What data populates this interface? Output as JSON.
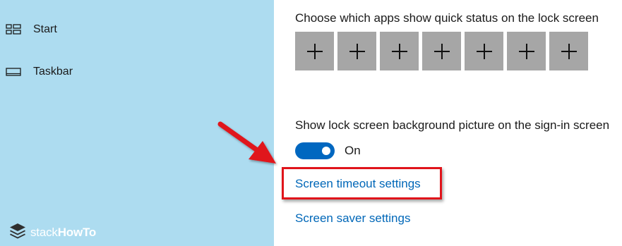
{
  "sidebar": {
    "background": "#addcf0",
    "items": [
      {
        "label": "Start",
        "icon": "start-icon"
      },
      {
        "label": "Taskbar",
        "icon": "taskbar-icon"
      }
    ],
    "watermark": {
      "text_regular": "stack",
      "text_bold": "HowTo",
      "icon": "stack-layers-icon"
    }
  },
  "main": {
    "quick_status_heading": "Choose which apps show quick status on the lock screen",
    "quick_status_tiles": [
      "+",
      "+",
      "+",
      "+",
      "+",
      "+",
      "+"
    ],
    "background_setting_label": "Show lock screen background picture on the sign-in screen",
    "toggle": {
      "state": "On",
      "value": true,
      "color": "#0067c0"
    },
    "links": {
      "screen_timeout": "Screen timeout settings",
      "screen_saver": "Screen saver settings"
    }
  },
  "annotation": {
    "color": "#e0141b",
    "highlighted": "Screen timeout settings"
  }
}
